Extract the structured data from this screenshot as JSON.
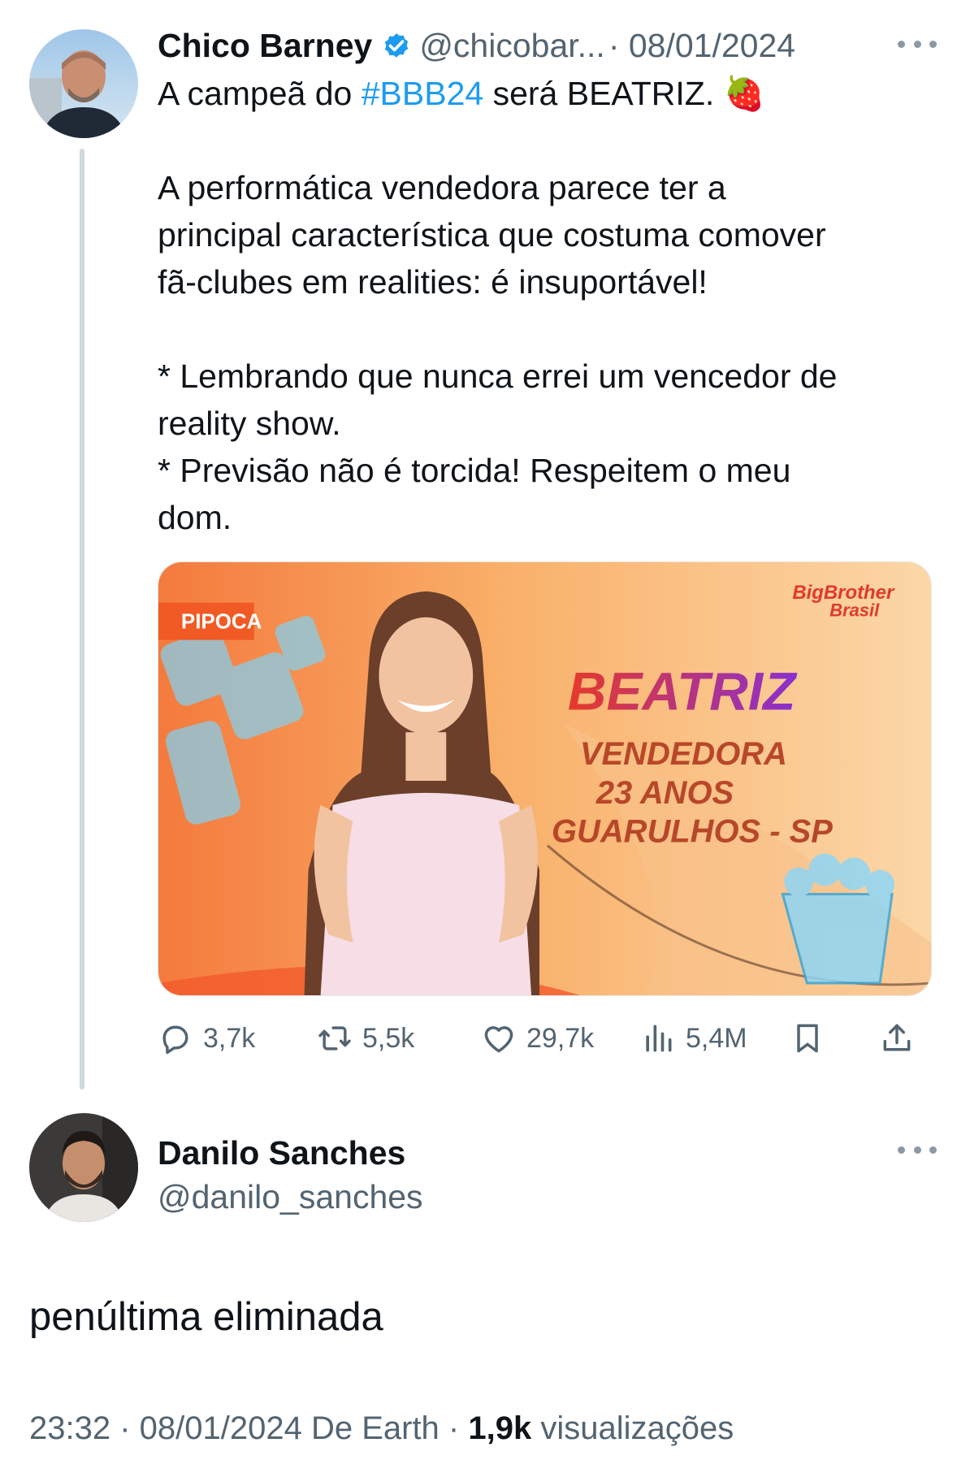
{
  "parent_tweet": {
    "author_name": "Chico Barney",
    "handle": "@chicobar...",
    "date": "· 08/01/2024",
    "line1_prefix": "A campeã do ",
    "hashtag": "#BBB24",
    "line1_suffix": " será BEATRIZ. 🍓",
    "body": "\n\nA performática vendedora parece ter a\nprincipal característica que costuma comover\nfã-clubes em realities: é insuportável!\n\n* Lembrando que nunca errei um vencedor de\nreality show.\n* Previsão não é torcida! Respeitem o meu\ndom.",
    "media": {
      "tag": "PIPOCA",
      "logo_top": "BigBrother",
      "logo_bottom": "Brasil",
      "name": "BEATRIZ",
      "line1": "VENDEDORA",
      "line2": "23 ANOS",
      "line3": "GUARULHOS - SP"
    },
    "stats": {
      "replies": "3,7k",
      "retweets": "5,5k",
      "likes": "29,7k",
      "views": "5,4M"
    }
  },
  "reply_tweet": {
    "author_name": "Danilo Sanches",
    "handle": "@danilo_sanches",
    "text": "penúltima eliminada",
    "time": "23:32 · 08/01/2024 De Earth · ",
    "views_count": "1,9k",
    "views_label": " visualizações"
  },
  "icons": {
    "verified": "verified-badge-icon",
    "more": "more-icon",
    "reply": "reply-icon",
    "retweet": "retweet-icon",
    "like": "heart-icon",
    "views": "analytics-icon",
    "bookmark": "bookmark-icon",
    "share": "share-icon"
  },
  "colors": {
    "link": "#1d9bf0",
    "secondary": "#536471",
    "thread_line": "#cfd9de",
    "media_orange": "#f7a35c",
    "beatriz_red": "#e0342c",
    "tag_orange": "#f15a24"
  }
}
